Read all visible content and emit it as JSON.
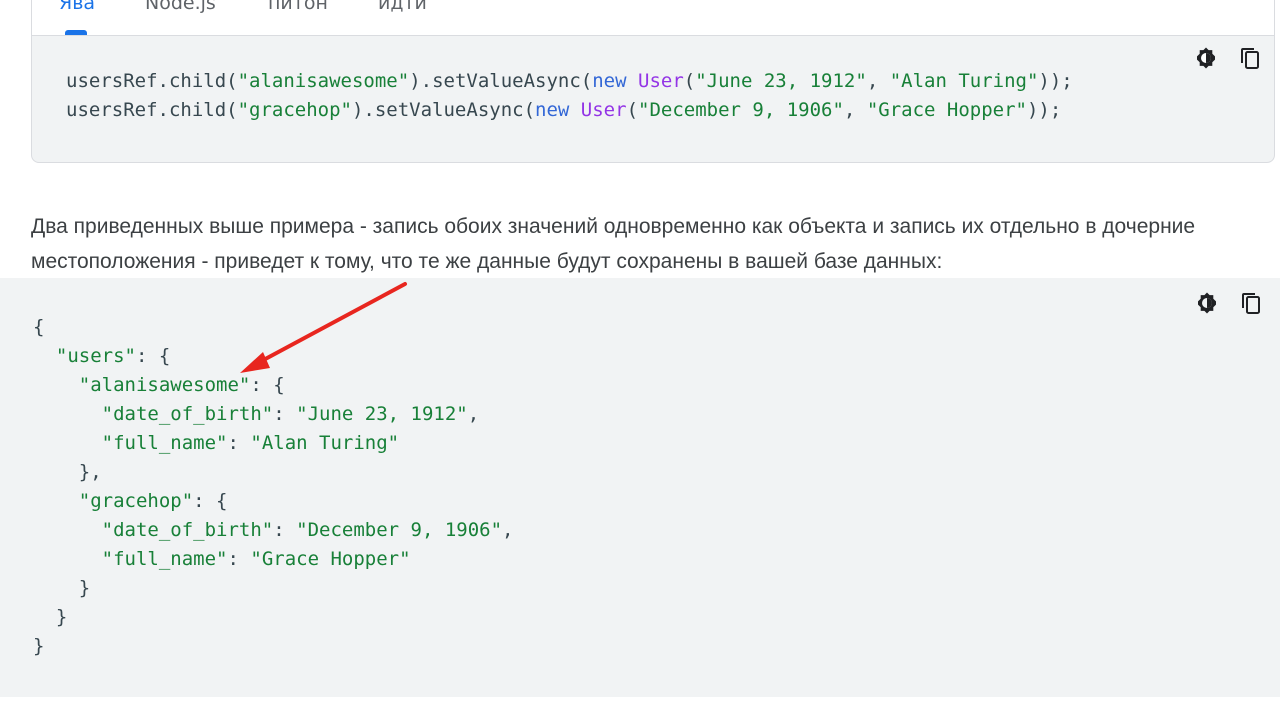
{
  "tabs": [
    {
      "label": "Ява",
      "active": true
    },
    {
      "label": "Node.js",
      "active": false
    },
    {
      "label": "питон",
      "active": false
    },
    {
      "label": "идти",
      "active": false
    }
  ],
  "tool_icons": {
    "theme": "contrast-icon",
    "copy": "copy-icon"
  },
  "java_code": {
    "line1": {
      "p1": "usersRef.child(",
      "s1": "\"alanisawesome\"",
      "p2": ").setValueAsync(",
      "kw": "new",
      "sp": " ",
      "type": "User",
      "p3": "(",
      "s2": "\"June 23, 1912\"",
      "p4": ", ",
      "s3": "\"Alan Turing\"",
      "p5": "));"
    },
    "line2": {
      "p1": "usersRef.child(",
      "s1": "\"gracehop\"",
      "p2": ").setValueAsync(",
      "kw": "new",
      "sp": " ",
      "type": "User",
      "p3": "(",
      "s2": "\"December 9, 1906\"",
      "p4": ", ",
      "s3": "\"Grace Hopper\"",
      "p5": "));"
    }
  },
  "paragraph": "Два приведенных выше примера - запись обоих значений одновременно как объекта и запись их отдельно в дочерние местоположения - приведет к тому, что те же данные будут сохранены в вашей базе данных:",
  "json_code": {
    "open": "{",
    "users_key": "\"users\"",
    "alan_key": "\"alanisawesome\"",
    "dob_key": "\"date_of_birth\"",
    "alan_dob": "\"June 23, 1912\"",
    "name_key": "\"full_name\"",
    "alan_name": "\"Alan Turing\"",
    "grace_key": "\"gracehop\"",
    "grace_dob": "\"December 9, 1906\"",
    "grace_name": "\"Grace Hopper\"",
    "close": "}"
  },
  "annotation": {
    "color": "#e8261f"
  }
}
